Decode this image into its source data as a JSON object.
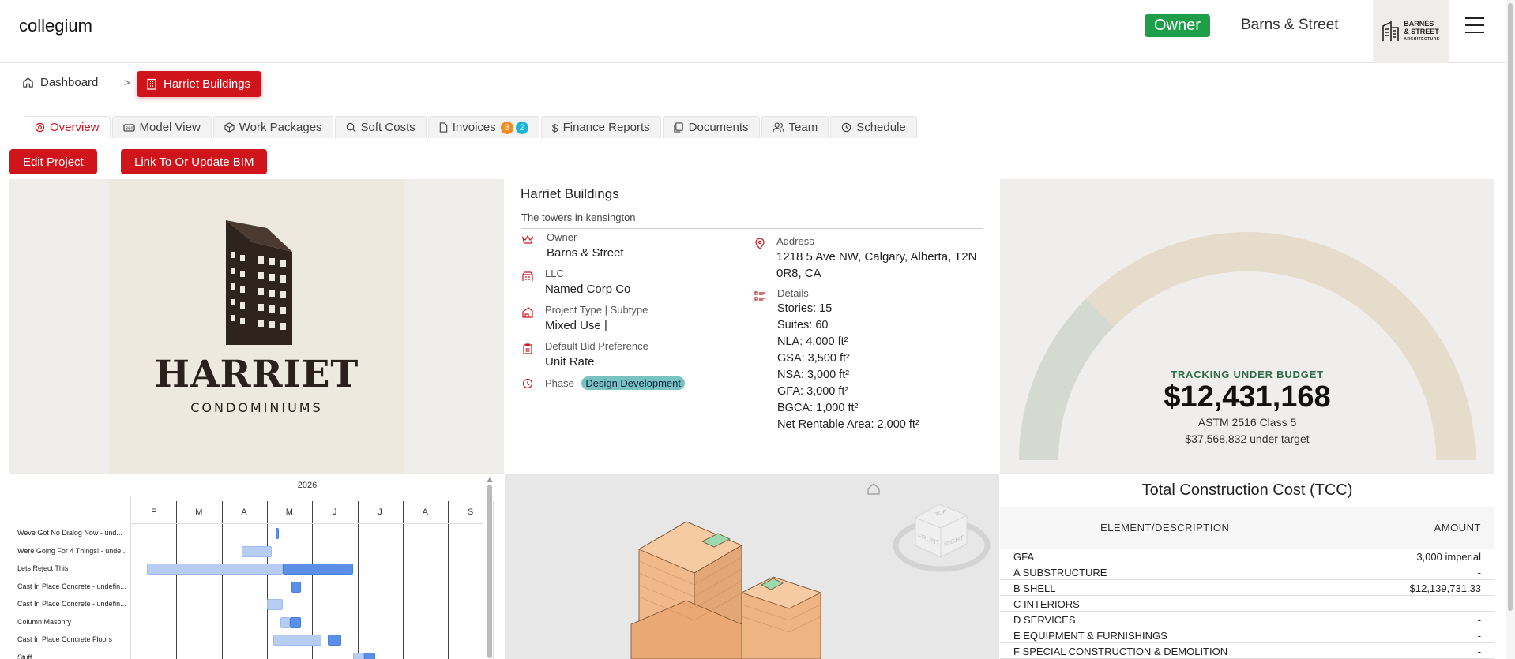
{
  "app": {
    "brand": "collegium"
  },
  "header": {
    "role": "Owner",
    "company": "Barns & Street",
    "logo_line1": "BARNES",
    "logo_line2": "& STREET",
    "logo_sub": "ARCHITECTURE"
  },
  "breadcrumb": {
    "home": "Dashboard",
    "separator": ">",
    "current": "Harriet Buildings"
  },
  "tabs": [
    {
      "label": "Overview",
      "icon": "target-icon"
    },
    {
      "label": "Model View",
      "icon": "view-360-icon"
    },
    {
      "label": "Work Packages",
      "icon": "package-icon"
    },
    {
      "label": "Soft Costs",
      "icon": "search-dollar-icon"
    },
    {
      "label": "Invoices",
      "icon": "file-icon",
      "badges": [
        "8",
        "2"
      ]
    },
    {
      "label": "Finance Reports",
      "icon": "dollar-icon"
    },
    {
      "label": "Documents",
      "icon": "documents-icon"
    },
    {
      "label": "Team",
      "icon": "users-icon"
    },
    {
      "label": "Schedule",
      "icon": "clock-icon"
    }
  ],
  "actions": {
    "edit": "Edit Project",
    "bim": "Link To Or Update BIM"
  },
  "project_image": {
    "name": "HARRIET",
    "sub": "CONDOMINIUMS"
  },
  "project": {
    "title": "Harriet Buildings",
    "subtitle": "The towers in kensington",
    "owner_label": "Owner",
    "owner": "Barns & Street",
    "llc_label": "LLC",
    "llc": "Named Corp Co",
    "type_label": "Project Type | Subtype",
    "type": "Mixed Use |",
    "bid_label": "Default Bid Preference",
    "bid": "Unit Rate",
    "phase_label": "Phase",
    "phase": "Design Development",
    "address_label": "Address",
    "address": "1218 5 Ave NW, Calgary, Alberta, T2N 0R8, CA",
    "details_label": "Details",
    "details": [
      "Stories: 15",
      "Suites: 60",
      "NLA: 4,000 ft²",
      "GSA: 3,500 ft²",
      "NSA: 3,000 ft²",
      "GFA: 3,000 ft²",
      "BGCA: 1,000 ft²",
      "Net Rentable Area: 2,000 ft²"
    ]
  },
  "gauge": {
    "status": "TRACKING UNDER BUDGET",
    "amount": "$12,431,168",
    "standard": "ASTM 2516 Class 5",
    "under": "$37,568,832 under target",
    "fraction": 0.25,
    "colors": {
      "fill": "#d4d9d1",
      "track": "#e6dccc"
    }
  },
  "gantt": {
    "year": "2026",
    "months": [
      "F",
      "M",
      "A",
      "M",
      "J",
      "J",
      "A",
      "S"
    ],
    "tasks": [
      {
        "label": "Weve Got No Dialog Now - und...",
        "bars": [
          {
            "start": 3.2,
            "len": 0.06,
            "dark": true
          }
        ]
      },
      {
        "label": "Were Going For 4 Things! - unde...",
        "bars": [
          {
            "start": 2.45,
            "len": 0.65,
            "dark": false
          }
        ]
      },
      {
        "label": "Lets Reject This",
        "bars": [
          {
            "start": 0.35,
            "len": 3.0,
            "dark": false
          },
          {
            "start": 3.35,
            "len": 1.55,
            "dark": true
          }
        ]
      },
      {
        "label": "Cast In Place Concrete - undefin...",
        "bars": [
          {
            "start": 3.55,
            "len": 0.2,
            "dark": true
          }
        ]
      },
      {
        "label": "Cast In Place Concrete - undefin...",
        "bars": [
          {
            "start": 3.0,
            "len": 0.35,
            "dark": false
          }
        ]
      },
      {
        "label": "Column Masonry",
        "bars": [
          {
            "start": 3.3,
            "len": 0.2,
            "dark": false
          },
          {
            "start": 3.5,
            "len": 0.25,
            "dark": true
          }
        ]
      },
      {
        "label": "Cast In Place Concrete Floors",
        "bars": [
          {
            "start": 3.15,
            "len": 1.05,
            "dark": false
          },
          {
            "start": 4.35,
            "len": 0.3,
            "dark": true
          }
        ]
      },
      {
        "label": "Stuff",
        "bars": [
          {
            "start": 4.9,
            "len": 0.25,
            "dark": false
          },
          {
            "start": 5.15,
            "len": 0.25,
            "dark": true
          }
        ]
      }
    ]
  },
  "model": {
    "cube_top": "TOP",
    "cube_front": "FRONT",
    "cube_right": "RIGHT"
  },
  "tcc": {
    "title": "Total Construction Cost (TCC)",
    "col_desc": "ELEMENT/DESCRIPTION",
    "col_amount": "AMOUNT",
    "rows": [
      {
        "desc": "GFA",
        "amount": "3,000 imperial"
      },
      {
        "desc": "A SUBSTRUCTURE",
        "amount": "-"
      },
      {
        "desc": "B SHELL",
        "amount": "$12,139,731.33"
      },
      {
        "desc": "C INTERIORS",
        "amount": "-"
      },
      {
        "desc": "D SERVICES",
        "amount": "-"
      },
      {
        "desc": "E EQUIPMENT & FURNISHINGS",
        "amount": "-"
      },
      {
        "desc": "F SPECIAL CONSTRUCTION & DEMOLITION",
        "amount": "-"
      }
    ]
  }
}
